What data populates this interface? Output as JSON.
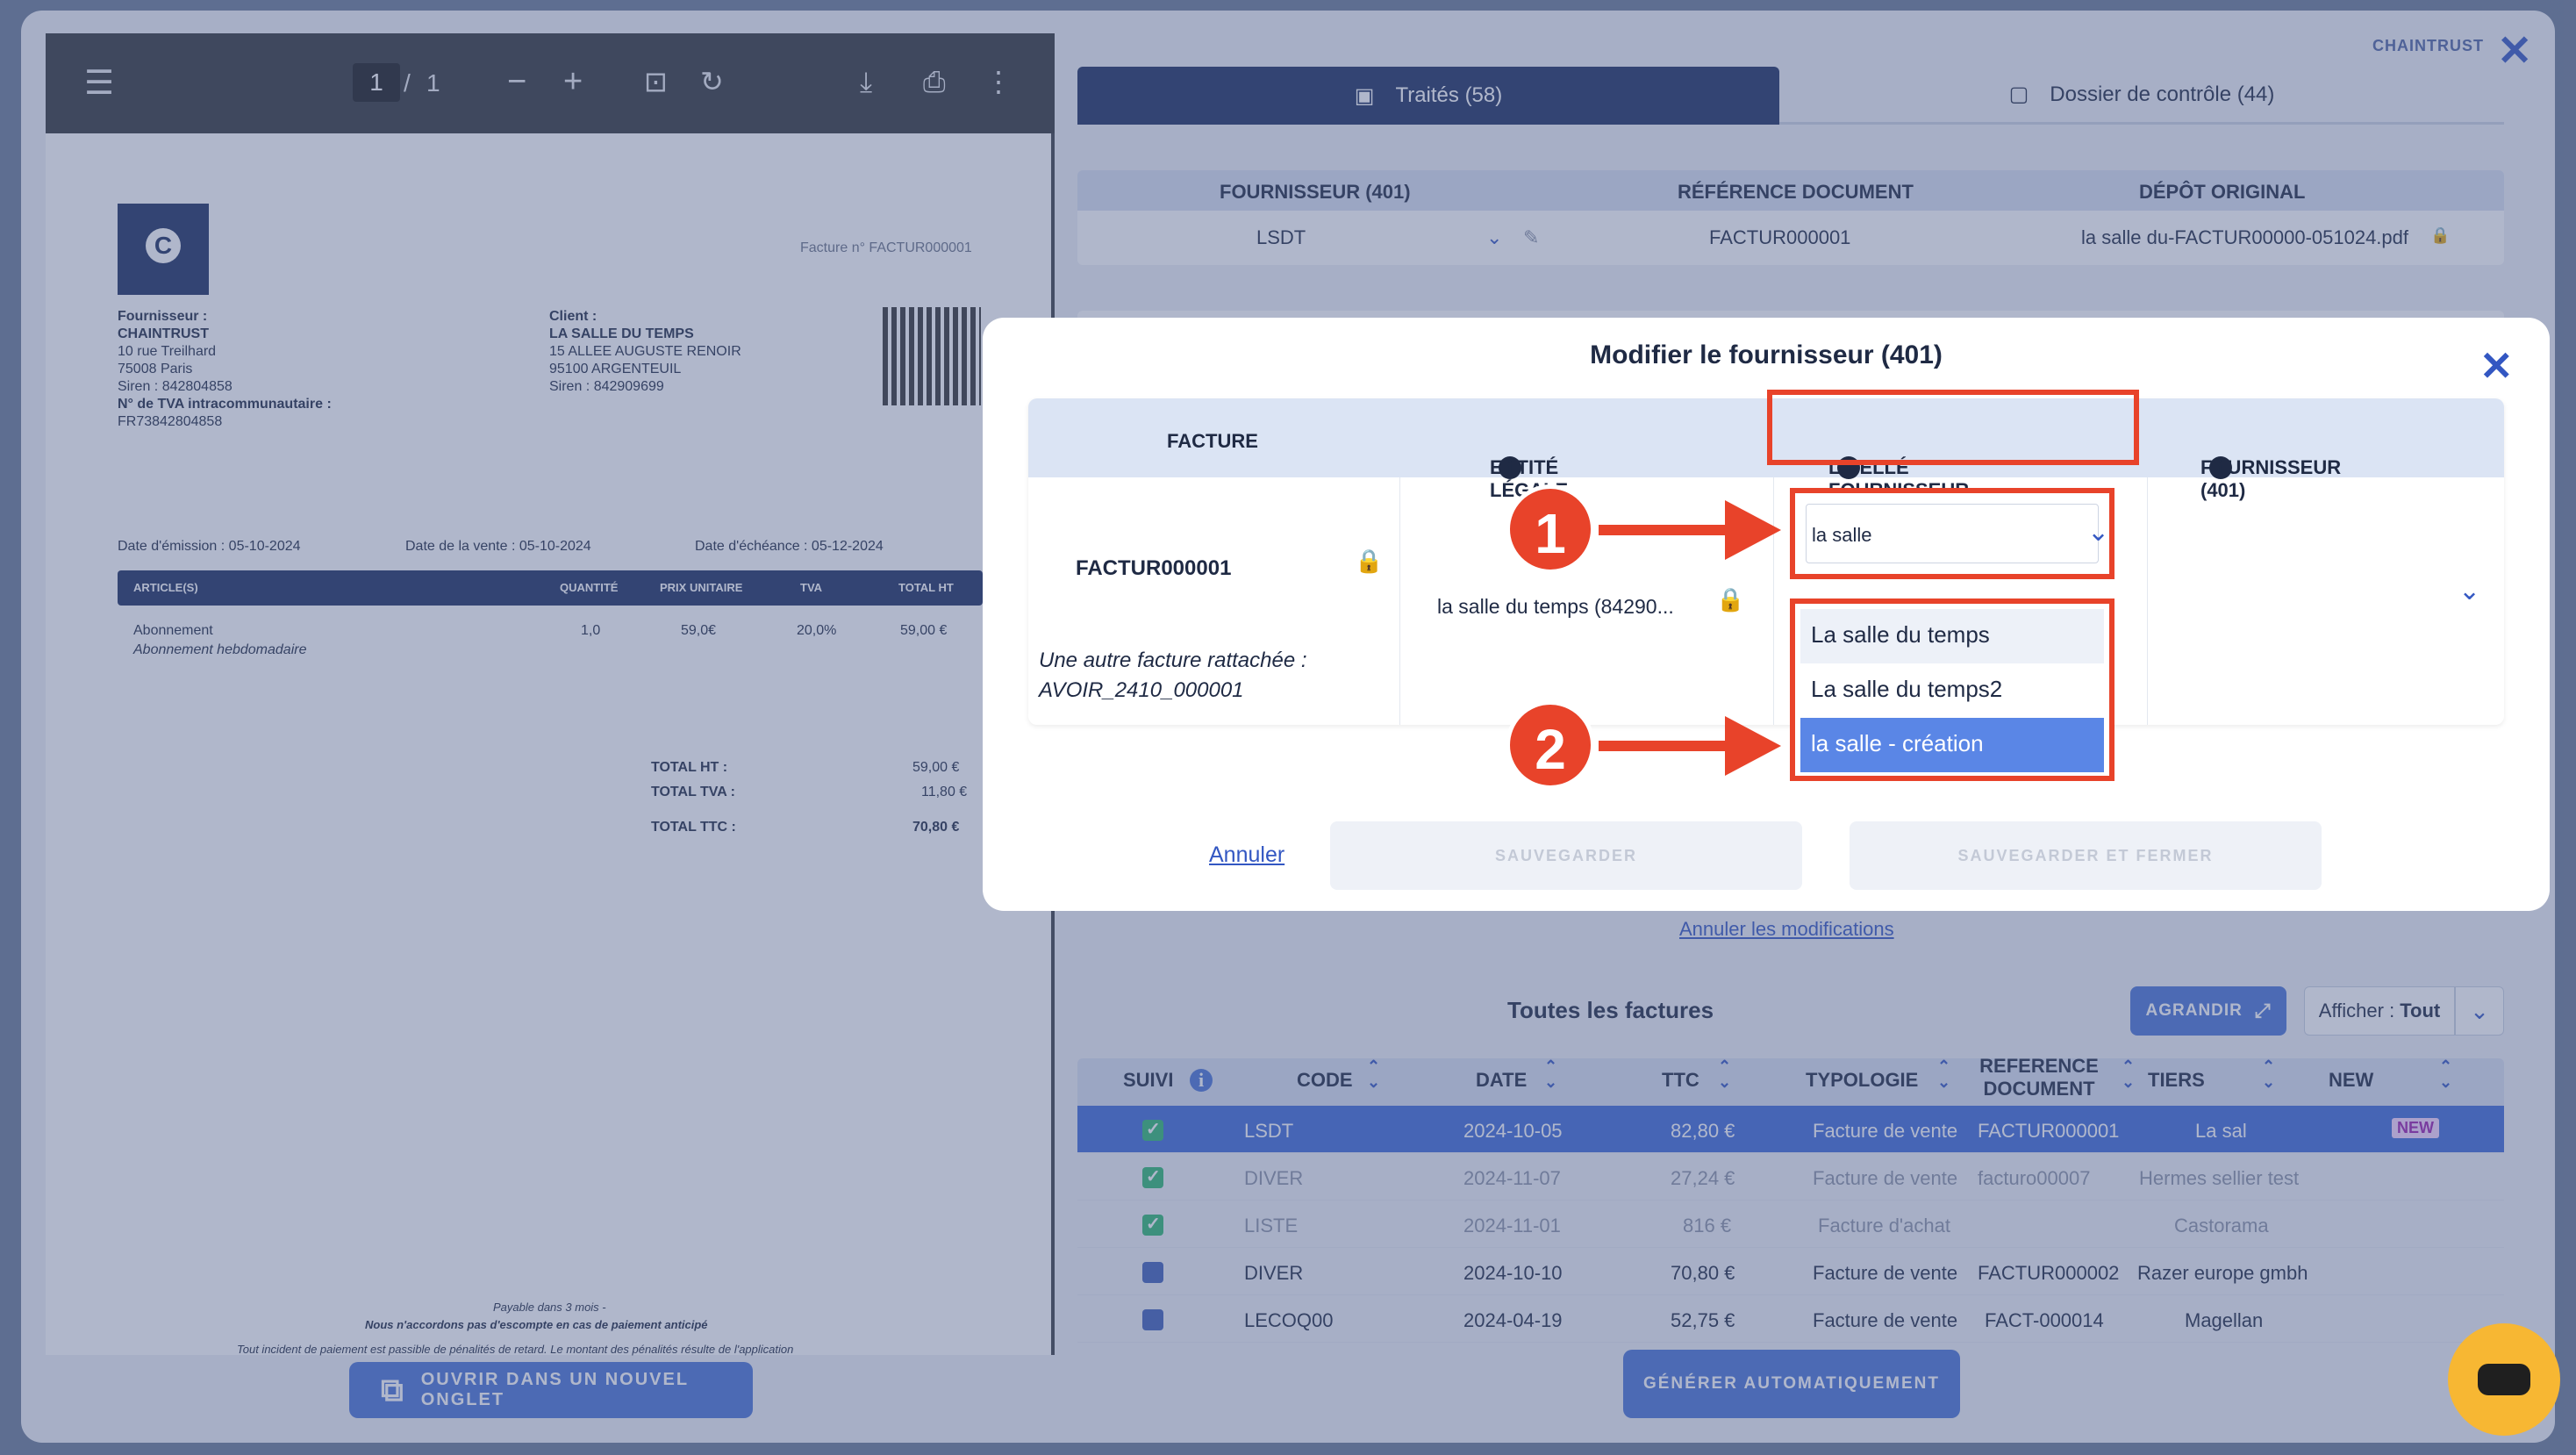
{
  "pdf": {
    "page_current": "1",
    "page_sep": "/",
    "page_total": "1",
    "invoice_ref": "Facture n° FACTUR000001",
    "supplier_label": "Fournisseur :",
    "supplier_name": "CHAINTRUST",
    "supplier_addr1": "10 rue Treilhard",
    "supplier_addr2": "75008 Paris",
    "supplier_siren": "Siren : 842804858",
    "supplier_tva_label": "N° de TVA intracommunautaire :",
    "supplier_tva": "FR73842804858",
    "client_label": "Client :",
    "client_name": "LA SALLE DU TEMPS",
    "client_addr1": "15 ALLEE AUGUSTE RENOIR",
    "client_addr2": "95100 ARGENTEUIL",
    "client_siren": "Siren : 842909699",
    "date_emission": "Date d'émission : 05-10-2024",
    "date_vente": "Date de la vente : 05-10-2024",
    "date_echeance": "Date d'échéance : 05-12-2024",
    "table_headers": [
      "ARTICLE(S)",
      "QUANTITÉ",
      "PRIX UNITAIRE",
      "TVA",
      "TOTAL HT"
    ],
    "line_item": {
      "name": "Abonnement",
      "desc": "Abonnement hebdomadaire",
      "qty": "1,0",
      "price": "59,0€",
      "tva": "20,0%",
      "total": "59,00 €"
    },
    "total_ht_label": "TOTAL HT :",
    "total_ht": "59,00 €",
    "total_tva_label": "TOTAL TVA :",
    "total_tva": "11,80 €",
    "total_ttc_label": "TOTAL TTC :",
    "total_ttc": "70,80 €",
    "footer1": "Payable dans 3 mois -",
    "footer2": "Nous n'accordons pas d'escompte en cas de paiement anticipé",
    "footer3": "Tout incident de paiement est passible de pénalités de retard. Le montant des pénalités résulte de l'application",
    "open_tab_label": "OUVRIR DANS UN NOUVEL ONGLET"
  },
  "brand": "CHAINTRUST",
  "tabs": [
    {
      "label": "Traités (58)"
    },
    {
      "label": "Dossier de contrôle (44)"
    }
  ],
  "info_table": {
    "headers": [
      "FOURNISSEUR (401)",
      "RÉFÉRENCE DOCUMENT",
      "DÉPÔT ORIGINAL"
    ],
    "supplier": "LSDT",
    "reference": "FACTUR000001",
    "original": "la salle du-FACTUR00000-051024.pdf"
  },
  "cancel_modifications": "Annuler les modifications",
  "all_invoices_title": "Toutes les factures",
  "agrandir": "AGRANDIR",
  "afficher_label": "Afficher :",
  "afficher_value": "Tout",
  "grid": {
    "headers": [
      "SUIVI",
      "CODE",
      "DATE",
      "TTC",
      "TYPOLOGIE",
      "REFERENCE DOCUMENT",
      "TIERS",
      "NEW"
    ],
    "rows": [
      {
        "code": "LSDT",
        "date": "2024-10-05",
        "ttc": "82,80 €",
        "typo": "Facture de vente",
        "ref": "FACTUR000001",
        "tiers": "La sal",
        "new": "NEW"
      },
      {
        "code": "DIVER",
        "date": "2024-11-07",
        "ttc": "27,24 €",
        "typo": "Facture de vente",
        "ref": "facturo00007",
        "tiers": "Hermes sellier test",
        "new": ""
      },
      {
        "code": "LISTE",
        "date": "2024-11-01",
        "ttc": "816 €",
        "typo": "Facture d'achat",
        "ref": "",
        "tiers": "Castorama",
        "new": ""
      },
      {
        "code": "DIVER",
        "date": "2024-10-10",
        "ttc": "70,80 €",
        "typo": "Facture de vente",
        "ref": "FACTUR000002",
        "tiers": "Razer europe gmbh",
        "new": ""
      },
      {
        "code": "LECOQ00",
        "date": "2024-04-19",
        "ttc": "52,75 €",
        "typo": "Facture de vente",
        "ref": "FACT-000014",
        "tiers": "Magellan",
        "new": ""
      }
    ]
  },
  "generer": "GÉNÉRER AUTOMATIQUEMENT",
  "modal": {
    "title": "Modifier le fournisseur (401)",
    "headers": [
      "FACTURE",
      "ENTITÉ LÉGALE",
      "LIBELLÉ FOURNISSEUR",
      "FOURNISSEUR (401)"
    ],
    "info_icon_glyph": "i",
    "facture_id": "FACTUR000001",
    "attached_line1": "Une autre facture rattachée :",
    "attached_line2": "AVOIR_2410_000001",
    "entity_value": "la salle du temps (84290...",
    "search_value": "la salle",
    "options": [
      "La salle du temps",
      "La salle du temps2",
      "la salle - création"
    ],
    "step1": "1",
    "step2": "2",
    "cancel": "Annuler",
    "save": "SAUVEGARDER",
    "save_close": "SAUVEGARDER ET FERMER"
  },
  "colors": {
    "accent": "#3357c2",
    "navy": "#1d2f5f",
    "highlight": "#e8432a",
    "option_selected": "#5a86e6",
    "chat": "#f7b733"
  }
}
